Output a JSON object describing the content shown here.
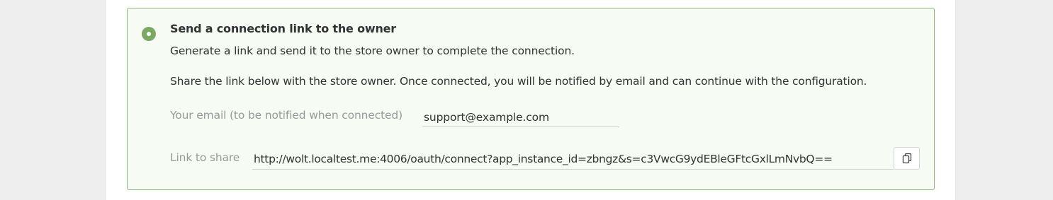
{
  "option": {
    "title": "Send a connection link to the owner",
    "description": "Generate a link and send it to the store owner to complete the connection.",
    "selected": true
  },
  "share_text": "Share the link below with the store owner. Once connected, you will be notified by email and can continue with the configuration.",
  "email_field": {
    "label": "Your email (to be notified when connected)",
    "value": "support@example.com"
  },
  "link_field": {
    "label": "Link to share",
    "value": "http://wolt.localtest.me:4006/oauth/connect?app_instance_id=zbngz&s=c3VwcG9ydEBleGFtcGxlLmNvbQ=="
  },
  "copy_button": {
    "icon": "copy-icon"
  },
  "colors": {
    "accent_green": "#7aa963",
    "card_border": "#8bb873",
    "card_background": "#f6fbf3",
    "label_gray": "#999999",
    "text": "#333333"
  }
}
